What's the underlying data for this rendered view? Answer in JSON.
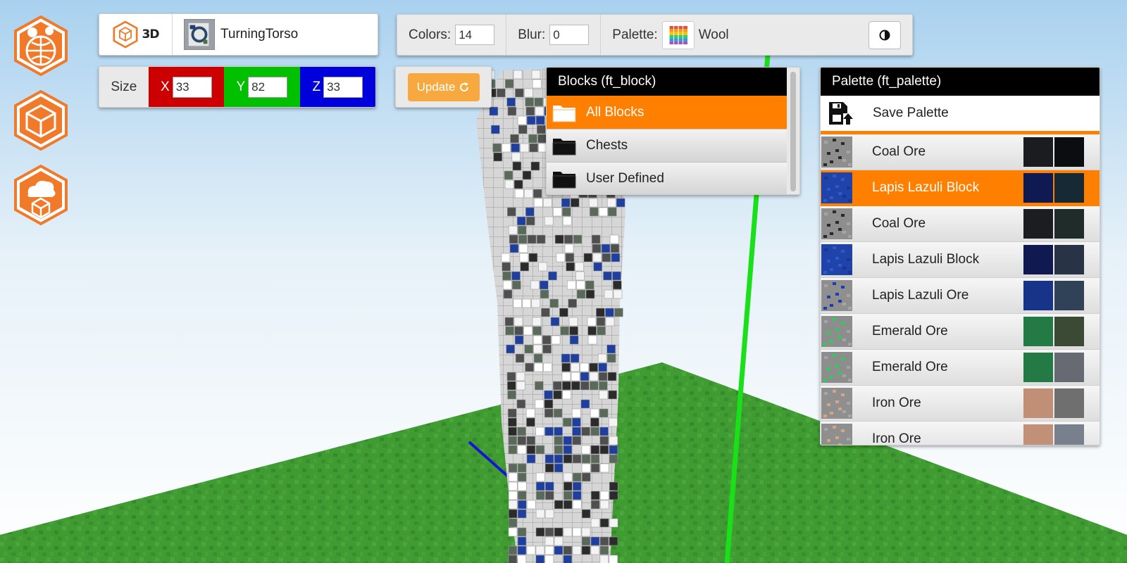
{
  "toolbar": {
    "mode_label": "3D",
    "model_name": "TurningTorso"
  },
  "size": {
    "label": "Size",
    "x_label": "X",
    "x_value": "33",
    "y_label": "Y",
    "y_value": "82",
    "z_label": "Z",
    "z_value": "33"
  },
  "options": {
    "colors_label": "Colors:",
    "colors_value": "14",
    "blur_label": "Blur:",
    "blur_value": "0",
    "palette_label": "Palette:",
    "palette_value": "Wool"
  },
  "update": {
    "label": "Update"
  },
  "blocks": {
    "title": "Blocks (ft_block)",
    "items": [
      {
        "label": "All Blocks",
        "active": true
      },
      {
        "label": "Chests",
        "active": false
      },
      {
        "label": "User Defined",
        "active": false
      }
    ]
  },
  "palette": {
    "title": "Palette (ft_palette)",
    "save_label": "Save Palette",
    "items": [
      {
        "label": "Coal Ore",
        "texture": "coal",
        "colors": [
          "#1b1c20",
          "#0c0d10"
        ]
      },
      {
        "label": "Lapis Lazuli Block",
        "texture": "lapis-block",
        "colors": [
          "#101a52",
          "#162a35"
        ],
        "active": true
      },
      {
        "label": "Coal Ore",
        "texture": "coal",
        "colors": [
          "#1c1d20",
          "#1f2c2a"
        ]
      },
      {
        "label": "Lapis Lazuli Block",
        "texture": "lapis-block",
        "colors": [
          "#111a50",
          "#293346"
        ]
      },
      {
        "label": "Lapis Lazuli Ore",
        "texture": "lapis-ore",
        "colors": [
          "#17338a",
          "#2f4258"
        ]
      },
      {
        "label": "Emerald Ore",
        "texture": "emerald",
        "colors": [
          "#247a45",
          "#3b4a35"
        ]
      },
      {
        "label": "Emerald Ore",
        "texture": "emerald",
        "colors": [
          "#247a45",
          "#676a72"
        ]
      },
      {
        "label": "Iron Ore",
        "texture": "iron",
        "colors": [
          "#c18f75",
          "#6f6f6f"
        ]
      },
      {
        "label": "Iron Ore",
        "texture": "iron",
        "colors": [
          "#c28f77",
          "#77808c"
        ]
      }
    ]
  },
  "colors": {
    "accent": "#ff7f00",
    "x_axis": "#cc0000",
    "y_axis": "#00c000",
    "z_axis": "#0000dd",
    "update_button": "#f7a93f",
    "ground": "#3f9b32"
  },
  "icons": {
    "logo_1": "globe-hex-icon",
    "logo_2": "cube-hex-icon",
    "logo_3": "cloud-cube-hex-icon"
  }
}
